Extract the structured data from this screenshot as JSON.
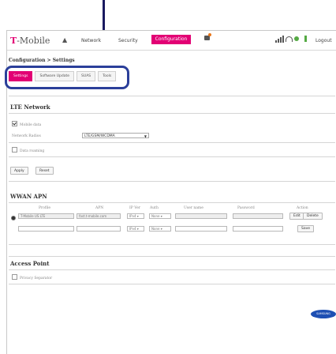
{
  "nav": {
    "brand": "-Mobile",
    "brand_t": "T",
    "network": "Network",
    "security": "Security",
    "configuration": "Configuration",
    "logout": "Logout"
  },
  "breadcrumb": "Configuration > Settings",
  "subtabs": [
    "Settings",
    "Software Update",
    "SUAS",
    "Tools"
  ],
  "lte": {
    "title": "LTE Network",
    "mobile_data_label": "Mobile data",
    "mobile_data_checked": true,
    "network_radios_label": "Network Radios",
    "network_radios_value": "LTE/GSM/WCDMA",
    "data_roaming_label": "Data roaming",
    "data_roaming_checked": false,
    "apply": "Apply",
    "reset": "Reset"
  },
  "wwan": {
    "title": "WWAN APN",
    "headers": [
      "Profile",
      "APN",
      "IP Ver",
      "Auth",
      "User name",
      "Password",
      "Action"
    ],
    "row1": {
      "profile": "T-Mobile US LTE",
      "apn": "fast.t-mobile.com",
      "ipver": "IPv4",
      "auth": "None",
      "edit": "Edit",
      "delete": "Delete"
    },
    "row2": {
      "ipver": "IPv4",
      "auth": "None",
      "save": "Save"
    }
  },
  "access_point": {
    "title": "Access Point",
    "privacy_label": "Privacy Separator",
    "privacy_checked": false
  },
  "logo": "SAMSUNG"
}
